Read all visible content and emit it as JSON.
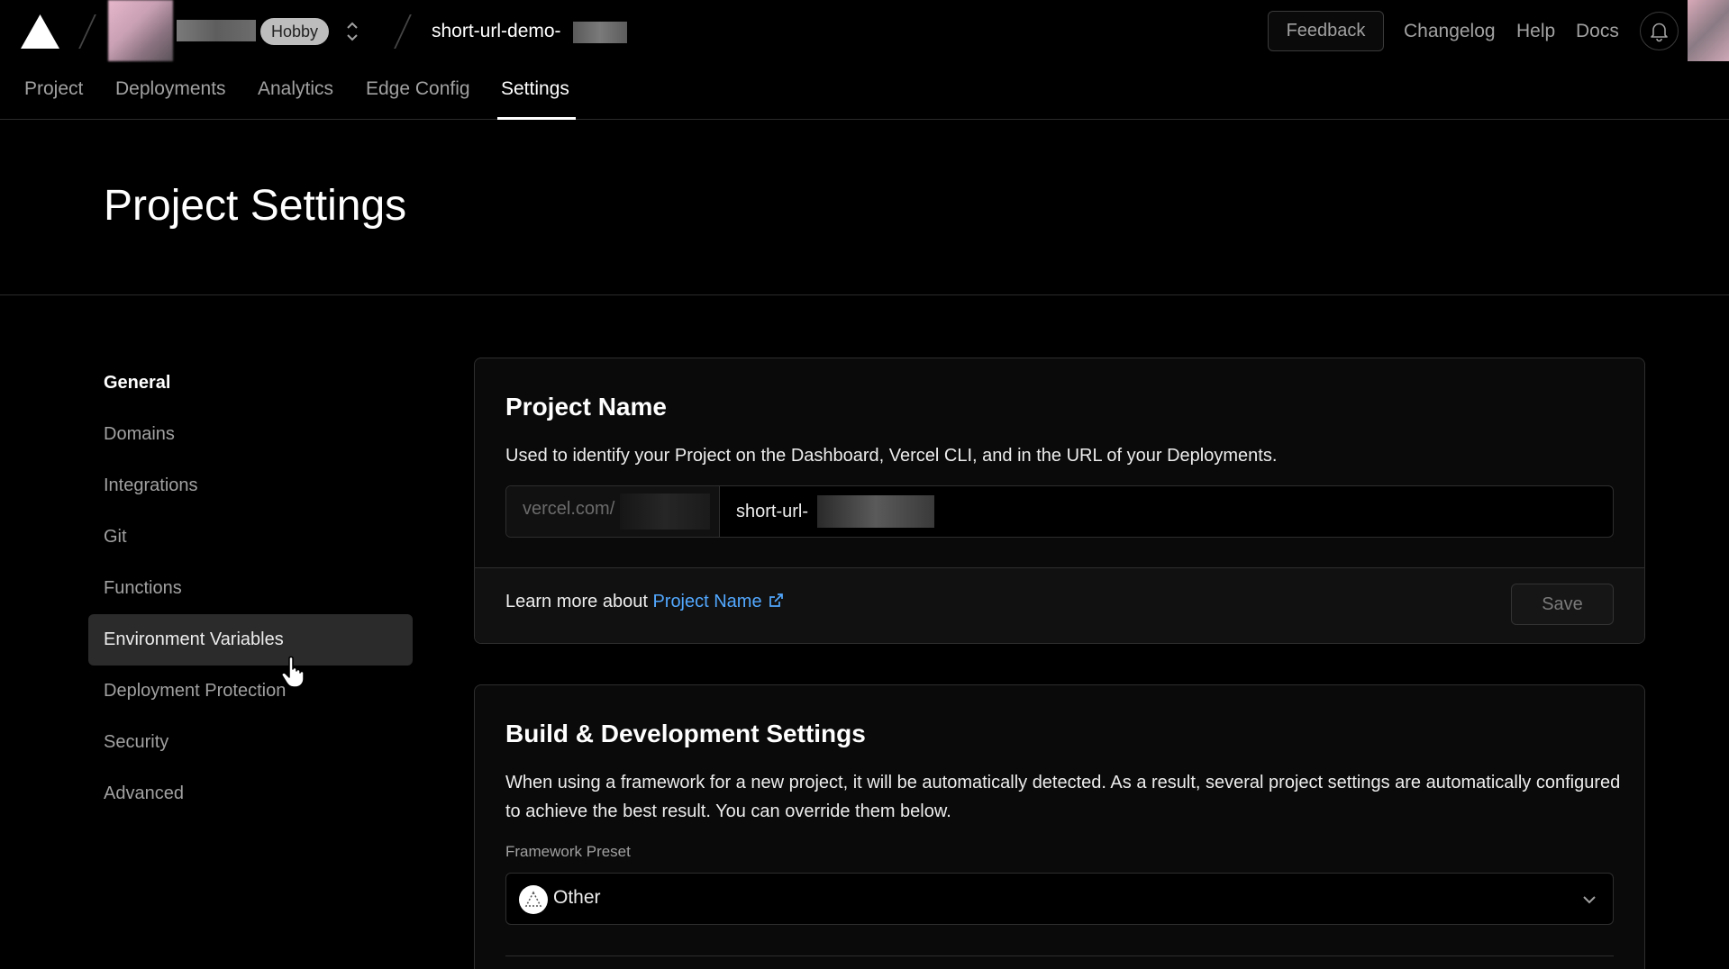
{
  "topbar": {
    "plan_badge": "Hobby",
    "project_name": "short-url-demo-",
    "feedback_label": "Feedback",
    "links": [
      "Changelog",
      "Help",
      "Docs"
    ]
  },
  "tabs": [
    "Project",
    "Deployments",
    "Analytics",
    "Edge Config",
    "Settings"
  ],
  "active_tab": "Settings",
  "page_title": "Project Settings",
  "sidebar": {
    "items": [
      "General",
      "Domains",
      "Integrations",
      "Git",
      "Functions",
      "Environment Variables",
      "Deployment Protection",
      "Security",
      "Advanced"
    ],
    "active": "General",
    "hovered": "Environment Variables"
  },
  "project_name_card": {
    "title": "Project Name",
    "description": "Used to identify your Project on the Dashboard, Vercel CLI, and in the URL of your Deployments.",
    "url_prefix": "vercel.com/",
    "input_value": "short-url-",
    "learn_more_text": "Learn more about ",
    "learn_more_link": "Project Name",
    "save_label": "Save"
  },
  "build_card": {
    "title": "Build & Development Settings",
    "description": "When using a framework for a new project, it will be automatically detected. As a result, several project settings are automatically configured to achieve the best result. You can override them below.",
    "framework_label": "Framework Preset",
    "framework_value": "Other"
  },
  "colors": {
    "background": "#000000",
    "link": "#52a8ff",
    "hover_bg": "#2b2b2b"
  }
}
